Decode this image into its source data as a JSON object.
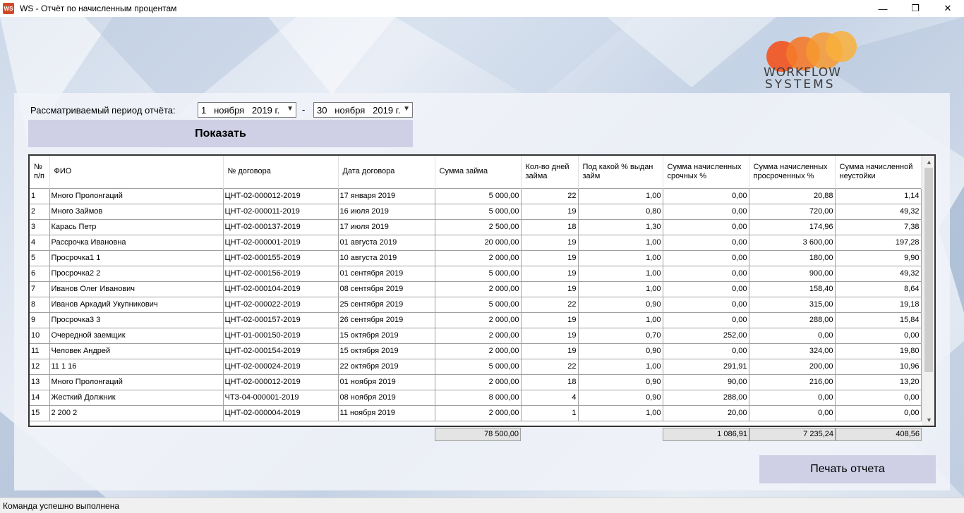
{
  "window": {
    "icon_text": "WS",
    "title": "WS - Отчёт по начисленным процентам",
    "minimize": "—",
    "maximize": "❐",
    "close": "✕"
  },
  "logo": {
    "line1": "WORKFLOW",
    "line2": "SYSTEMS"
  },
  "filter": {
    "period_label": "Рассматриваемый период отчёта:",
    "date_from": "1   ноября   2019 г.",
    "date_to": "30   ноября   2019 г.",
    "separator": "-",
    "show_button": "Показать"
  },
  "table": {
    "columns": [
      "№ п/п",
      "ФИО",
      "№ договора",
      "Дата договора",
      "Сумма займа",
      "Кол-во дней займа",
      "Под какой % выдан займ",
      "Сумма начисленных срочных %",
      "Сумма начисленных просроченных %",
      "Сумма начисленной неустойки"
    ],
    "rows": [
      [
        "1",
        "Много Пролонгаций",
        "ЦНТ-02-000012-2019",
        "17 января 2019",
        "5 000,00",
        "22",
        "1,00",
        "0,00",
        "20,88",
        "1,14"
      ],
      [
        "2",
        "Много Займов",
        "ЦНТ-02-000011-2019",
        "16 июля 2019",
        "5 000,00",
        "19",
        "0,80",
        "0,00",
        "720,00",
        "49,32"
      ],
      [
        "3",
        "Карась Петр",
        "ЦНТ-02-000137-2019",
        "17 июля 2019",
        "2 500,00",
        "18",
        "1,30",
        "0,00",
        "174,96",
        "7,38"
      ],
      [
        "4",
        "Рассрочка Ивановна",
        "ЦНТ-02-000001-2019",
        "01 августа 2019",
        "20 000,00",
        "19",
        "1,00",
        "0,00",
        "3 600,00",
        "197,28"
      ],
      [
        "5",
        "Просрочка1 1",
        "ЦНТ-02-000155-2019",
        "10 августа 2019",
        "2 000,00",
        "19",
        "1,00",
        "0,00",
        "180,00",
        "9,90"
      ],
      [
        "6",
        "Просрочка2 2",
        "ЦНТ-02-000156-2019",
        "01 сентября 2019",
        "5 000,00",
        "19",
        "1,00",
        "0,00",
        "900,00",
        "49,32"
      ],
      [
        "7",
        "Иванов Олег Иванович",
        "ЦНТ-02-000104-2019",
        "08 сентября 2019",
        "2 000,00",
        "19",
        "1,00",
        "0,00",
        "158,40",
        "8,64"
      ],
      [
        "8",
        "Иванов Аркадий Укупникович",
        "ЦНТ-02-000022-2019",
        "25 сентября 2019",
        "5 000,00",
        "22",
        "0,90",
        "0,00",
        "315,00",
        "19,18"
      ],
      [
        "9",
        "Просрочка3 3",
        "ЦНТ-02-000157-2019",
        "26 сентября 2019",
        "2 000,00",
        "19",
        "1,00",
        "0,00",
        "288,00",
        "15,84"
      ],
      [
        "10",
        "Очередной заемщик",
        "ЦНТ-01-000150-2019",
        "15 октября 2019",
        "2 000,00",
        "19",
        "0,70",
        "252,00",
        "0,00",
        "0,00"
      ],
      [
        "11",
        "Человек Андрей",
        "ЦНТ-02-000154-2019",
        "15 октября 2019",
        "2 000,00",
        "19",
        "0,90",
        "0,00",
        "324,00",
        "19,80"
      ],
      [
        "12",
        "11 1 16",
        "ЦНТ-02-000024-2019",
        "22 октября 2019",
        "5 000,00",
        "22",
        "1,00",
        "291,91",
        "200,00",
        "10,96"
      ],
      [
        "13",
        "Много Пролонгаций",
        "ЦНТ-02-000012-2019",
        "01 ноября 2019",
        "2 000,00",
        "18",
        "0,90",
        "90,00",
        "216,00",
        "13,20"
      ],
      [
        "14",
        "Жесткий Должник",
        "ЧТЗ-04-000001-2019",
        "08 ноября 2019",
        "8 000,00",
        "4",
        "0,90",
        "288,00",
        "0,00",
        "0,00"
      ],
      [
        "15",
        "2 200 2",
        "ЦНТ-02-000004-2019",
        "11 ноября 2019",
        "2 000,00",
        "1",
        "1,00",
        "20,00",
        "0,00",
        "0,00"
      ]
    ],
    "scroll_up": "▲",
    "scroll_down": "▼"
  },
  "totals": {
    "loan_sum": "78 500,00",
    "term_interest": "1 086,91",
    "overdue_interest": "7 235,24",
    "penalty": "408,56"
  },
  "print_button": "Печать отчета",
  "status": "Команда успешно выполнена"
}
